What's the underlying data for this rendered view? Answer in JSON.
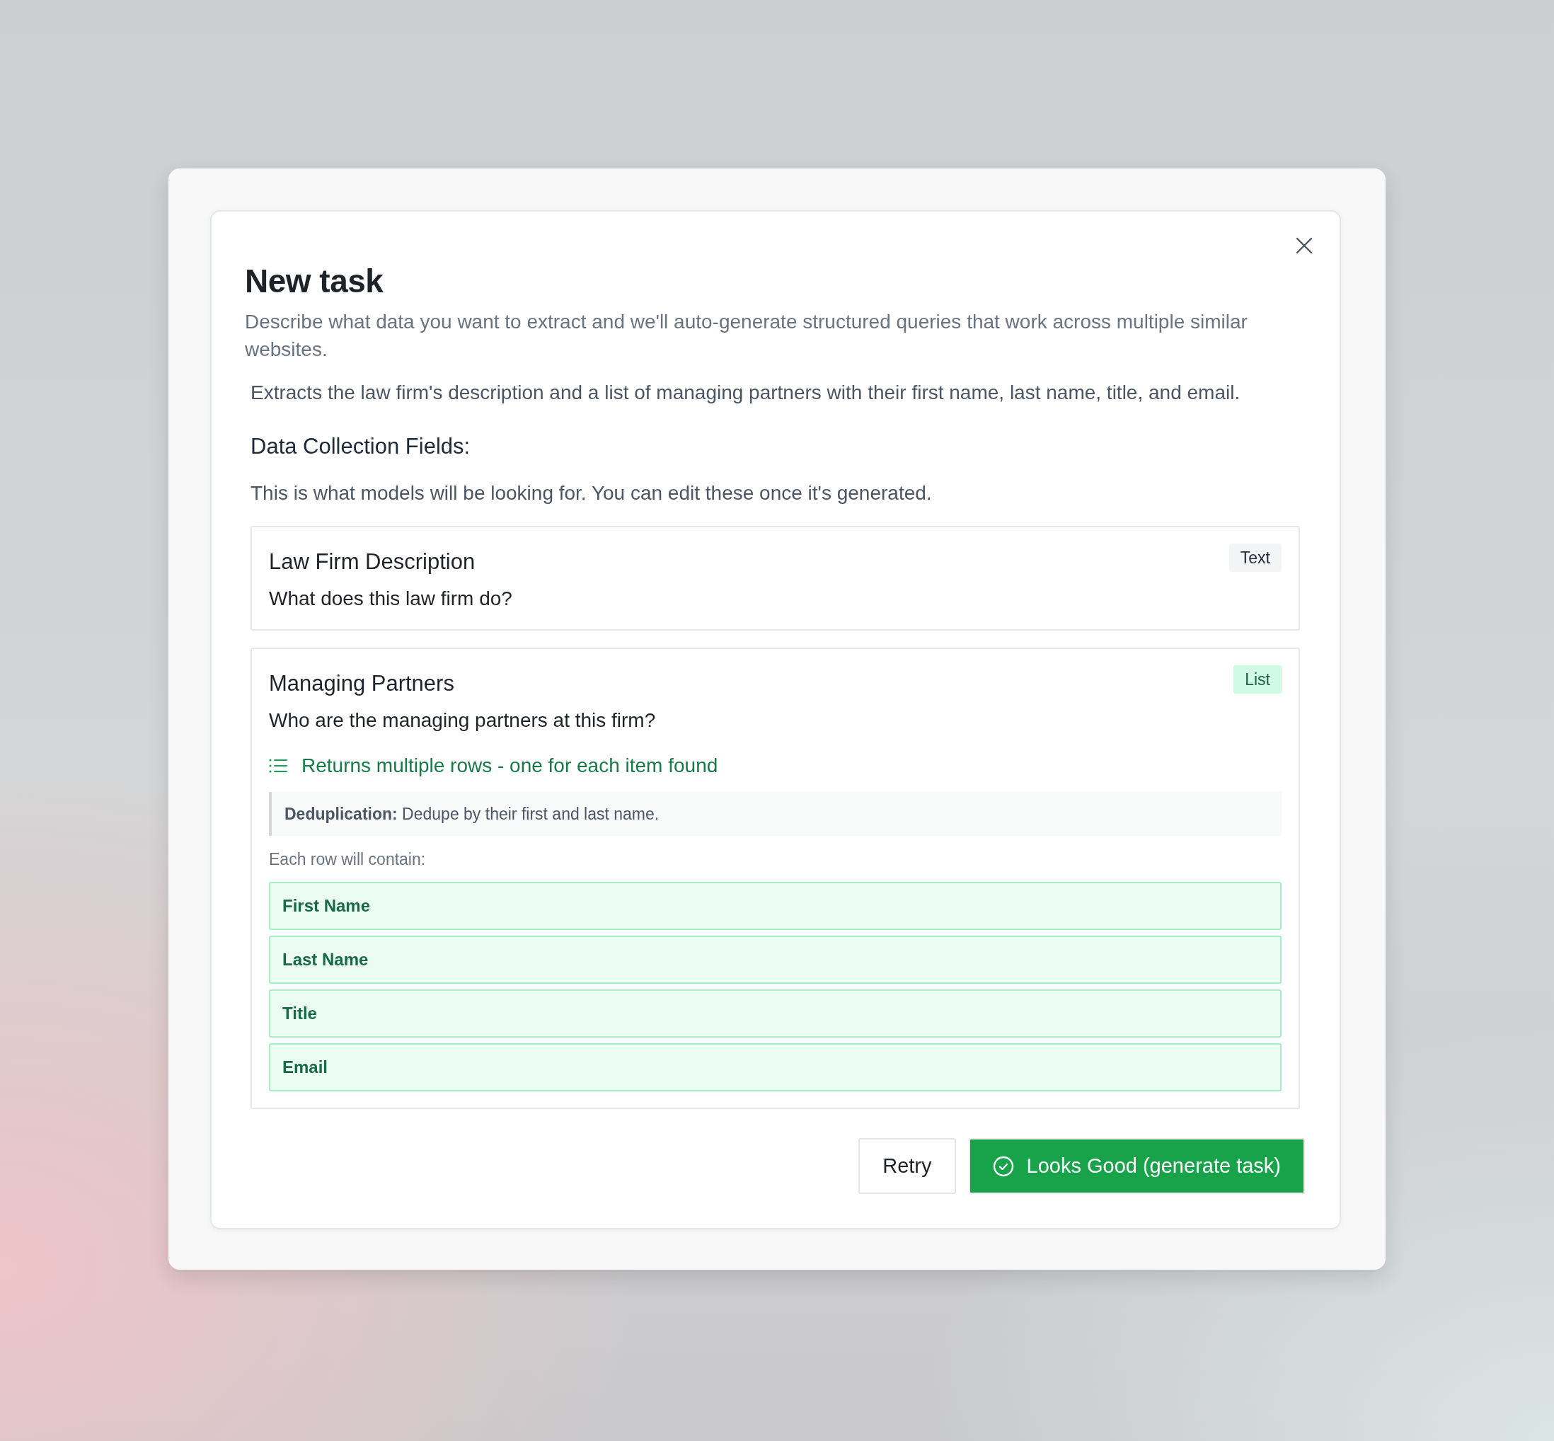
{
  "modal": {
    "title": "New task",
    "subtitle": "Describe what data you want to extract and we'll auto-generate structured queries that work across multiple similar websites."
  },
  "summary": "Extracts the law firm's description and a list of managing partners with their first name, last name, title, and email.",
  "fields_section": {
    "heading": "Data Collection Fields:",
    "note": "This is what models will be looking for. You can edit these once it's generated."
  },
  "fields": [
    {
      "kind": "text",
      "name": "Law Firm Description",
      "question": "What does this law firm do?",
      "badge": "Text"
    },
    {
      "kind": "list",
      "name": "Managing Partners",
      "question": "Who are the managing partners at this firm?",
      "badge": "List",
      "returns_note": "Returns multiple rows - one for each item found",
      "deduplication": "**Deduplication:** Dedupe by their first and last name.",
      "row_caption": "Each row will contain:",
      "columns": [
        "First Name",
        "Last Name",
        "Title",
        "Email"
      ]
    }
  ],
  "buttons": [
    {
      "kind": "secondary",
      "label": "Retry"
    },
    {
      "kind": "primary",
      "label": "Looks Good (generate task)"
    }
  ]
}
